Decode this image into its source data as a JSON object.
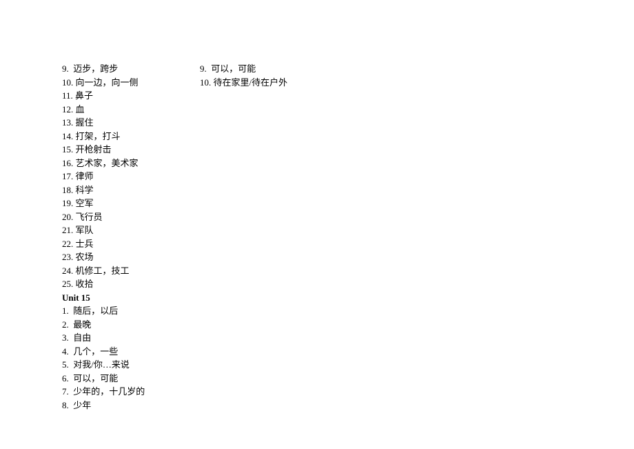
{
  "col1": {
    "sectionA": [
      {
        "n": "9.",
        "t": "迈步，跨步"
      },
      {
        "n": "10.",
        "t": "向一边，向一侧"
      },
      {
        "n": "11.",
        "t": "鼻子"
      },
      {
        "n": "12.",
        "t": "血"
      },
      {
        "n": "13.",
        "t": "握住"
      },
      {
        "n": "14.",
        "t": "打架，打斗"
      },
      {
        "n": "15.",
        "t": "开枪射击"
      },
      {
        "n": "16.",
        "t": "艺术家，美术家"
      },
      {
        "n": "17.",
        "t": "律师"
      },
      {
        "n": "18.",
        "t": "科学"
      },
      {
        "n": "19.",
        "t": "空军"
      },
      {
        "n": "20.",
        "t": "飞行员"
      },
      {
        "n": "21.",
        "t": "军队"
      },
      {
        "n": "22.",
        "t": "士兵"
      },
      {
        "n": "23.",
        "t": "农场"
      },
      {
        "n": "24.",
        "t": "机修工，技工"
      },
      {
        "n": "25.",
        "t": "收拾"
      }
    ],
    "heading": "Unit 15",
    "sectionB": [
      {
        "n": "1.",
        "t": "随后，以后"
      },
      {
        "n": "2.",
        "t": "最晚"
      },
      {
        "n": "3.",
        "t": "自由"
      },
      {
        "n": "4.",
        "t": "几个，一些"
      },
      {
        "n": "5.",
        "t": "对我/你…来说"
      },
      {
        "n": "6.",
        "t": "可以，可能"
      },
      {
        "n": "7.",
        "t": "少年的，十几岁的"
      },
      {
        "n": "8.",
        "t": "少年"
      }
    ]
  },
  "col2": [
    {
      "n": "9.",
      "t": "可以，可能"
    },
    {
      "n": "10.",
      "t": "待在家里/待在户外"
    }
  ]
}
